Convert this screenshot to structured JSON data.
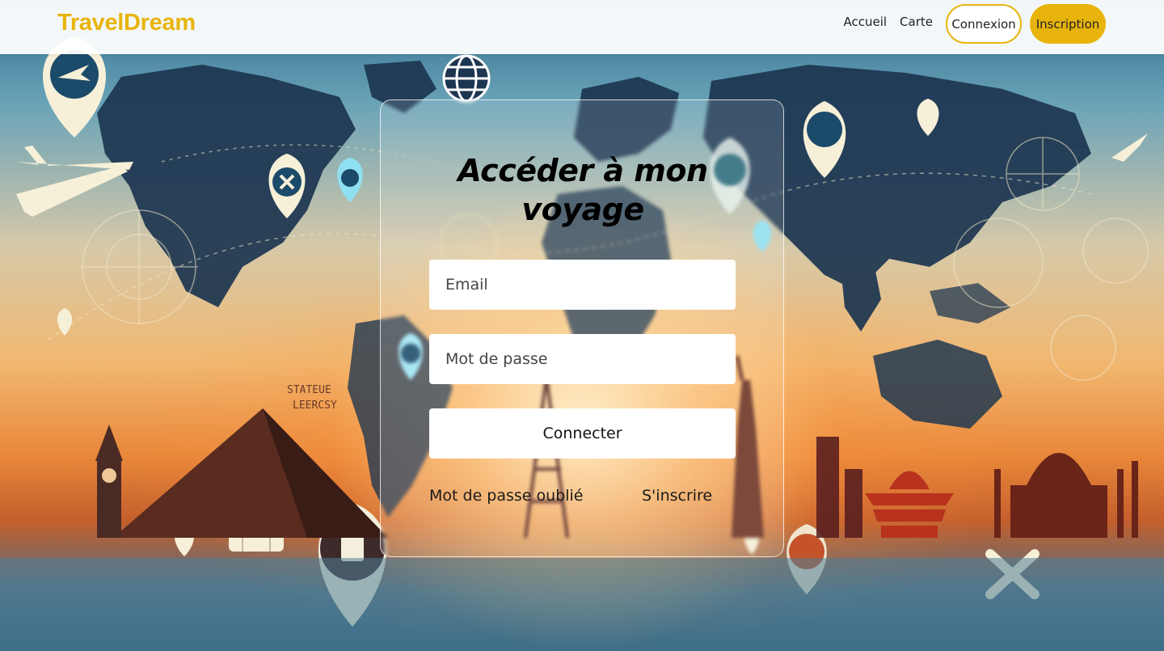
{
  "brand": {
    "name": "TravelDream",
    "color": "#e8b40c"
  },
  "nav": {
    "links": [
      {
        "label": "Accueil"
      },
      {
        "label": "Carte"
      }
    ],
    "login_label": "Connexion",
    "signup_label": "Inscription"
  },
  "login": {
    "title": "Accéder à mon voyage",
    "email_placeholder": "Email",
    "password_placeholder": "Mot de passe",
    "submit_label": "Connecter",
    "forgot_label": "Mot de passe oublié",
    "signup_link_label": "S'inscrire"
  },
  "background": {
    "pyramid_sign": [
      "STATEUE",
      "LEERCSY"
    ],
    "icons": [
      "airplane-icon",
      "map-pin-icon",
      "globe-icon",
      "compass-icon",
      "suitcase-icon",
      "eiffel-tower-icon",
      "big-ben-icon",
      "pyramid-icon",
      "statue-of-liberty-icon",
      "taj-mahal-icon",
      "pagoda-icon"
    ]
  }
}
